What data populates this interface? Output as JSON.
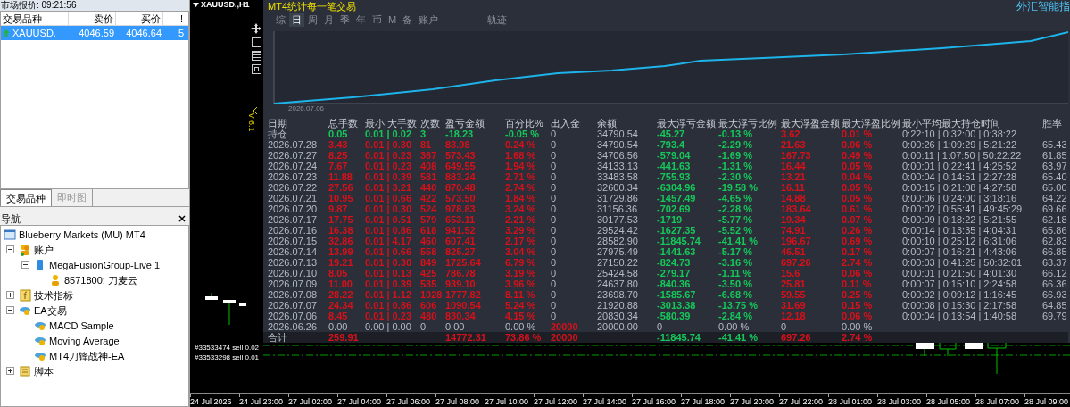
{
  "market_watch": {
    "title": "市场报价: 09:21:56",
    "columns": [
      "交易品种",
      "卖价",
      "买价",
      "!"
    ],
    "rows": [
      {
        "symbol": "XAUUSD.",
        "bid": "4046.59",
        "ask": "4046.64",
        "spread": "5",
        "selected": true
      }
    ],
    "tabs": [
      {
        "label": "交易品种",
        "selected": true
      },
      {
        "label": "即时图",
        "selected": false
      }
    ]
  },
  "navigator": {
    "title": "导航",
    "tree": [
      {
        "label": "Blueberry Markets (MU) MT4",
        "kind": "terminal",
        "children": [
          {
            "label": "账户",
            "kind": "accounts",
            "expanded": true,
            "children": [
              {
                "label": "MegaFusionGroup-Live 1",
                "kind": "server",
                "expanded": true,
                "children": [
                  {
                    "label": "8571800: 刀麦云",
                    "kind": "account"
                  }
                ]
              }
            ]
          },
          {
            "label": "技术指标",
            "kind": "indicators",
            "expanded": false
          },
          {
            "label": "EA交易",
            "kind": "experts",
            "expanded": true,
            "children": [
              {
                "label": "MACD Sample",
                "kind": "expert"
              },
              {
                "label": "Moving Average",
                "kind": "expert"
              },
              {
                "label": "MT4刀锋战神-EA",
                "kind": "expert"
              }
            ]
          },
          {
            "label": "脚本",
            "kind": "scripts",
            "expanded": false
          }
        ]
      }
    ]
  },
  "chart": {
    "symbol": "XAUUSD.,H1",
    "order_labels": [
      "#33533474 sell 0.02",
      "#33533298 sell 0.01"
    ],
    "time_axis": [
      "24 Jul 2026",
      "24 Jul 23:00",
      "27 Jul 02:00",
      "27 Jul 04:00",
      "27 Jul 06:00",
      "27 Jul 08:00",
      "27 Jul 10:00",
      "27 Jul 12:00",
      "27 Jul 14:00",
      "27 Jul 16:00",
      "27 Jul 18:00",
      "27 Jul 20:00",
      "27 Jul 22:00",
      "28 Jul 01:00",
      "28 Jul 03:00",
      "28 Jul 05:00",
      "28 Jul 07:00",
      "28 Jul 09:00"
    ]
  },
  "stats_panel": {
    "title": "MT4统计每一笔交易",
    "brand": "外汇智能指",
    "version": "V 6.1",
    "tabs": [
      {
        "label": "综",
        "selected": false
      },
      {
        "label": "日",
        "selected": true
      },
      {
        "label": "周",
        "selected": false
      },
      {
        "label": "月",
        "selected": false
      },
      {
        "label": "季",
        "selected": false
      },
      {
        "label": "年",
        "selected": false
      },
      {
        "label": "币",
        "selected": false
      },
      {
        "label": "M",
        "selected": false
      },
      {
        "label": "备",
        "selected": false
      },
      {
        "label": "账户",
        "selected": false
      },
      {
        "label": "轨迹",
        "selected": false
      }
    ],
    "equity_chart": {
      "start_date": "2026.07.06"
    },
    "table": {
      "columns": [
        "日期",
        "总手数",
        "最小|大手数",
        "次数",
        "盈亏金额",
        "百分比%",
        "出入金",
        "余额",
        "最大浮亏金额",
        "最大浮亏比例",
        "最大浮盈金额",
        "最大浮盈比例",
        "最小平均最大持仓时间",
        "胜率"
      ],
      "rows": [
        {
          "date": {
            "text": "持仓"
          },
          "total_lots": {
            "text": "0.05",
            "color": "#16c75a"
          },
          "min_max_lots": {
            "text": "0.01 | 0.02",
            "color": "#16c75a"
          },
          "trades": {
            "text": "3",
            "color": "#16c75a"
          },
          "profit": {
            "text": "-18.23",
            "color": "#16c75a"
          },
          "percent": {
            "text": "-0.05 %",
            "color": "#16c75a"
          },
          "deposit": {
            "text": "0"
          },
          "balance": {
            "text": "34790.54"
          },
          "max_float_loss": {
            "text": "-45.27",
            "color": "#16c75a"
          },
          "max_float_loss_pct": {
            "text": "-0.13 %",
            "color": "#16c75a"
          },
          "max_float_profit": {
            "text": "3.62",
            "color": "#d8101a"
          },
          "max_float_profit_pct": {
            "text": "0.01 %",
            "color": "#d8101a"
          },
          "hold_time": {
            "text": "0:22:10 | 0:32:00 | 0:38:22"
          }
        },
        {
          "date": {
            "text": "2026.07.28"
          },
          "total_lots": {
            "text": "3.43",
            "color": "#d8101a"
          },
          "min_max_lots": {
            "text": "0.01 | 0.30",
            "color": "#d8101a"
          },
          "trades": {
            "text": "81",
            "color": "#d8101a"
          },
          "profit": {
            "text": "83.98",
            "color": "#d8101a"
          },
          "percent": {
            "text": "0.24 %",
            "color": "#d8101a"
          },
          "deposit": {
            "text": "0"
          },
          "balance": {
            "text": "34790.54"
          },
          "max_float_loss": {
            "text": "-793.4",
            "color": "#16c75a"
          },
          "max_float_loss_pct": {
            "text": "-2.29 %",
            "color": "#16c75a"
          },
          "max_float_profit": {
            "text": "21.63",
            "color": "#d8101a"
          },
          "max_float_profit_pct": {
            "text": "0.06 %",
            "color": "#d8101a"
          },
          "hold_time": {
            "text": "0:00:26 | 1:09:29 | 5:21:22"
          },
          "win_rate": {
            "text": "65.43"
          }
        },
        {
          "date": {
            "text": "2026.07.27"
          },
          "total_lots": {
            "text": "8.25",
            "color": "#d8101a"
          },
          "min_max_lots": {
            "text": "0.01 | 0.23",
            "color": "#d8101a"
          },
          "trades": {
            "text": "367",
            "color": "#d8101a"
          },
          "profit": {
            "text": "573.43",
            "color": "#d8101a"
          },
          "percent": {
            "text": "1.68 %",
            "color": "#d8101a"
          },
          "deposit": {
            "text": "0"
          },
          "balance": {
            "text": "34706.56"
          },
          "max_float_loss": {
            "text": "-579.04",
            "color": "#16c75a"
          },
          "max_float_loss_pct": {
            "text": "-1.69 %",
            "color": "#16c75a"
          },
          "max_float_profit": {
            "text": "167.73",
            "color": "#d8101a"
          },
          "max_float_profit_pct": {
            "text": "0.49 %",
            "color": "#d8101a"
          },
          "hold_time": {
            "text": "0:00:11 | 1:07:50 | 50:22:22"
          },
          "win_rate": {
            "text": "61.85"
          }
        },
        {
          "date": {
            "text": "2026.07.24"
          },
          "total_lots": {
            "text": "7.67",
            "color": "#d8101a"
          },
          "min_max_lots": {
            "text": "0.01 | 0.23",
            "color": "#d8101a"
          },
          "trades": {
            "text": "408",
            "color": "#d8101a"
          },
          "profit": {
            "text": "649.55",
            "color": "#d8101a"
          },
          "percent": {
            "text": "1.94 %",
            "color": "#d8101a"
          },
          "deposit": {
            "text": "0"
          },
          "balance": {
            "text": "34133.13"
          },
          "max_float_loss": {
            "text": "-441.63",
            "color": "#16c75a"
          },
          "max_float_loss_pct": {
            "text": "-1.31 %",
            "color": "#16c75a"
          },
          "max_float_profit": {
            "text": "16.44",
            "color": "#d8101a"
          },
          "max_float_profit_pct": {
            "text": "0.05 %",
            "color": "#d8101a"
          },
          "hold_time": {
            "text": "0:00:01 | 0:22:41 | 4:25:52"
          },
          "win_rate": {
            "text": "63.97"
          }
        },
        {
          "date": {
            "text": "2026.07.23"
          },
          "total_lots": {
            "text": "11.88",
            "color": "#d8101a"
          },
          "min_max_lots": {
            "text": "0.01 | 0.39",
            "color": "#d8101a"
          },
          "trades": {
            "text": "581",
            "color": "#d8101a"
          },
          "profit": {
            "text": "883.24",
            "color": "#d8101a"
          },
          "percent": {
            "text": "2.71 %",
            "color": "#d8101a"
          },
          "deposit": {
            "text": "0"
          },
          "balance": {
            "text": "33483.58"
          },
          "max_float_loss": {
            "text": "-755.93",
            "color": "#16c75a"
          },
          "max_float_loss_pct": {
            "text": "-2.30 %",
            "color": "#16c75a"
          },
          "max_float_profit": {
            "text": "13.21",
            "color": "#d8101a"
          },
          "max_float_profit_pct": {
            "text": "0.04 %",
            "color": "#d8101a"
          },
          "hold_time": {
            "text": "0:00:04 | 0:14:51 | 2:27:28"
          },
          "win_rate": {
            "text": "65.40"
          }
        },
        {
          "date": {
            "text": "2026.07.22"
          },
          "total_lots": {
            "text": "27.56",
            "color": "#d8101a"
          },
          "min_max_lots": {
            "text": "0.01 | 3.21",
            "color": "#d8101a"
          },
          "trades": {
            "text": "440",
            "color": "#d8101a"
          },
          "profit": {
            "text": "870.48",
            "color": "#d8101a"
          },
          "percent": {
            "text": "2.74 %",
            "color": "#d8101a"
          },
          "deposit": {
            "text": "0"
          },
          "balance": {
            "text": "32600.34"
          },
          "max_float_loss": {
            "text": "-6304.96",
            "color": "#16c75a"
          },
          "max_float_loss_pct": {
            "text": "-19.58 %",
            "color": "#16c75a"
          },
          "max_float_profit": {
            "text": "16.11",
            "color": "#d8101a"
          },
          "max_float_profit_pct": {
            "text": "0.05 %",
            "color": "#d8101a"
          },
          "hold_time": {
            "text": "0:00:15 | 0:21:08 | 4:27:58"
          },
          "win_rate": {
            "text": "65.00"
          }
        },
        {
          "date": {
            "text": "2026.07.21"
          },
          "total_lots": {
            "text": "10.95",
            "color": "#d8101a"
          },
          "min_max_lots": {
            "text": "0.01 | 0.66",
            "color": "#d8101a"
          },
          "trades": {
            "text": "422",
            "color": "#d8101a"
          },
          "profit": {
            "text": "573.50",
            "color": "#d8101a"
          },
          "percent": {
            "text": "1.84 %",
            "color": "#d8101a"
          },
          "deposit": {
            "text": "0"
          },
          "balance": {
            "text": "31729.86"
          },
          "max_float_loss": {
            "text": "-1457.49",
            "color": "#16c75a"
          },
          "max_float_loss_pct": {
            "text": "-4.65 %",
            "color": "#16c75a"
          },
          "max_float_profit": {
            "text": "14.88",
            "color": "#d8101a"
          },
          "max_float_profit_pct": {
            "text": "0.05 %",
            "color": "#d8101a"
          },
          "hold_time": {
            "text": "0:00:06 | 0:24:00 | 3:18:16"
          },
          "win_rate": {
            "text": "64.22"
          }
        },
        {
          "date": {
            "text": "2026.07.20"
          },
          "total_lots": {
            "text": "9.87",
            "color": "#d8101a"
          },
          "min_max_lots": {
            "text": "0.01 | 0.30",
            "color": "#d8101a"
          },
          "trades": {
            "text": "524",
            "color": "#d8101a"
          },
          "profit": {
            "text": "978.83",
            "color": "#d8101a"
          },
          "percent": {
            "text": "3.24 %",
            "color": "#d8101a"
          },
          "deposit": {
            "text": "0"
          },
          "balance": {
            "text": "31156.36"
          },
          "max_float_loss": {
            "text": "-702.69",
            "color": "#16c75a"
          },
          "max_float_loss_pct": {
            "text": "-2.28 %",
            "color": "#16c75a"
          },
          "max_float_profit": {
            "text": "183.64",
            "color": "#d8101a"
          },
          "max_float_profit_pct": {
            "text": "0.61 %",
            "color": "#d8101a"
          },
          "hold_time": {
            "text": "0:00:02 | 0:55:41 | 49:45:29"
          },
          "win_rate": {
            "text": "69.66"
          }
        },
        {
          "date": {
            "text": "2026.07.17"
          },
          "total_lots": {
            "text": "17.75",
            "color": "#d8101a"
          },
          "min_max_lots": {
            "text": "0.01 | 0.51",
            "color": "#d8101a"
          },
          "trades": {
            "text": "579",
            "color": "#d8101a"
          },
          "profit": {
            "text": "653.11",
            "color": "#d8101a"
          },
          "percent": {
            "text": "2.21 %",
            "color": "#d8101a"
          },
          "deposit": {
            "text": "0"
          },
          "balance": {
            "text": "30177.53"
          },
          "max_float_loss": {
            "text": "-1719",
            "color": "#16c75a"
          },
          "max_float_loss_pct": {
            "text": "-5.77 %",
            "color": "#16c75a"
          },
          "max_float_profit": {
            "text": "19.34",
            "color": "#d8101a"
          },
          "max_float_profit_pct": {
            "text": "0.07 %",
            "color": "#d8101a"
          },
          "hold_time": {
            "text": "0:00:09 | 0:18:22 | 5:21:55"
          },
          "win_rate": {
            "text": "62.18"
          }
        },
        {
          "date": {
            "text": "2026.07.16"
          },
          "total_lots": {
            "text": "16.38",
            "color": "#d8101a"
          },
          "min_max_lots": {
            "text": "0.01 | 0.86",
            "color": "#d8101a"
          },
          "trades": {
            "text": "618",
            "color": "#d8101a"
          },
          "profit": {
            "text": "941.52",
            "color": "#d8101a"
          },
          "percent": {
            "text": "3.29 %",
            "color": "#d8101a"
          },
          "deposit": {
            "text": "0"
          },
          "balance": {
            "text": "29524.42"
          },
          "max_float_loss": {
            "text": "-1627.35",
            "color": "#16c75a"
          },
          "max_float_loss_pct": {
            "text": "-5.52 %",
            "color": "#16c75a"
          },
          "max_float_profit": {
            "text": "74.91",
            "color": "#d8101a"
          },
          "max_float_profit_pct": {
            "text": "0.26 %",
            "color": "#d8101a"
          },
          "hold_time": {
            "text": "0:00:14 | 0:13:35 | 4:04:31"
          },
          "win_rate": {
            "text": "65.86"
          }
        },
        {
          "date": {
            "text": "2026.07.15"
          },
          "total_lots": {
            "text": "32.86",
            "color": "#d8101a"
          },
          "min_max_lots": {
            "text": "0.01 | 4.17",
            "color": "#d8101a"
          },
          "trades": {
            "text": "460",
            "color": "#d8101a"
          },
          "profit": {
            "text": "607.41",
            "color": "#d8101a"
          },
          "percent": {
            "text": "2.17 %",
            "color": "#d8101a"
          },
          "deposit": {
            "text": "0"
          },
          "balance": {
            "text": "28582.90"
          },
          "max_float_loss": {
            "text": "-11845.74",
            "color": "#16c75a"
          },
          "max_float_loss_pct": {
            "text": "-41.41 %",
            "color": "#16c75a"
          },
          "max_float_profit": {
            "text": "196.67",
            "color": "#d8101a"
          },
          "max_float_profit_pct": {
            "text": "0.69 %",
            "color": "#d8101a"
          },
          "hold_time": {
            "text": "0:00:10 | 0:25:12 | 6:31:06"
          },
          "win_rate": {
            "text": "62.83"
          }
        },
        {
          "date": {
            "text": "2026.07.14"
          },
          "total_lots": {
            "text": "13.99",
            "color": "#d8101a"
          },
          "min_max_lots": {
            "text": "0.01 | 0.66",
            "color": "#d8101a"
          },
          "trades": {
            "text": "558",
            "color": "#d8101a"
          },
          "profit": {
            "text": "825.27",
            "color": "#d8101a"
          },
          "percent": {
            "text": "3.04 %",
            "color": "#d8101a"
          },
          "deposit": {
            "text": "0"
          },
          "balance": {
            "text": "27975.49"
          },
          "max_float_loss": {
            "text": "-1441.63",
            "color": "#16c75a"
          },
          "max_float_loss_pct": {
            "text": "-5.17 %",
            "color": "#16c75a"
          },
          "max_float_profit": {
            "text": "46.51",
            "color": "#d8101a"
          },
          "max_float_profit_pct": {
            "text": "0.17 %",
            "color": "#d8101a"
          },
          "hold_time": {
            "text": "0:00:07 | 0:16:21 | 4:43:06"
          },
          "win_rate": {
            "text": "66.85"
          }
        },
        {
          "date": {
            "text": "2026.07.13"
          },
          "total_lots": {
            "text": "19.21",
            "color": "#d8101a"
          },
          "min_max_lots": {
            "text": "0.01 | 0.30",
            "color": "#d8101a"
          },
          "trades": {
            "text": "849",
            "color": "#d8101a"
          },
          "profit": {
            "text": "1725.64",
            "color": "#d8101a"
          },
          "percent": {
            "text": "6.79 %",
            "color": "#d8101a"
          },
          "deposit": {
            "text": "0"
          },
          "balance": {
            "text": "27150.22"
          },
          "max_float_loss": {
            "text": "-824.73",
            "color": "#16c75a"
          },
          "max_float_loss_pct": {
            "text": "-3.16 %",
            "color": "#16c75a"
          },
          "max_float_profit": {
            "text": "697.26",
            "color": "#d8101a"
          },
          "max_float_profit_pct": {
            "text": "2.74 %",
            "color": "#d8101a"
          },
          "hold_time": {
            "text": "0:00:03 | 0:41:25 | 50:32:01"
          },
          "win_rate": {
            "text": "63.37"
          }
        },
        {
          "date": {
            "text": "2026.07.10"
          },
          "total_lots": {
            "text": "8.05",
            "color": "#d8101a"
          },
          "min_max_lots": {
            "text": "0.01 | 0.13",
            "color": "#d8101a"
          },
          "trades": {
            "text": "425",
            "color": "#d8101a"
          },
          "profit": {
            "text": "786.78",
            "color": "#d8101a"
          },
          "percent": {
            "text": "3.19 %",
            "color": "#d8101a"
          },
          "deposit": {
            "text": "0"
          },
          "balance": {
            "text": "25424.58"
          },
          "max_float_loss": {
            "text": "-279.17",
            "color": "#16c75a"
          },
          "max_float_loss_pct": {
            "text": "-1.11 %",
            "color": "#16c75a"
          },
          "max_float_profit": {
            "text": "15.6",
            "color": "#d8101a"
          },
          "max_float_profit_pct": {
            "text": "0.06 %",
            "color": "#d8101a"
          },
          "hold_time": {
            "text": "0:00:01 | 0:21:50 | 4:01:30"
          },
          "win_rate": {
            "text": "66.12"
          }
        },
        {
          "date": {
            "text": "2026.07.09"
          },
          "total_lots": {
            "text": "11.00",
            "color": "#d8101a"
          },
          "min_max_lots": {
            "text": "0.01 | 0.39",
            "color": "#d8101a"
          },
          "trades": {
            "text": "535",
            "color": "#d8101a"
          },
          "profit": {
            "text": "939.10",
            "color": "#d8101a"
          },
          "percent": {
            "text": "3.96 %",
            "color": "#d8101a"
          },
          "deposit": {
            "text": "0"
          },
          "balance": {
            "text": "24637.80"
          },
          "max_float_loss": {
            "text": "-840.36",
            "color": "#16c75a"
          },
          "max_float_loss_pct": {
            "text": "-3.50 %",
            "color": "#16c75a"
          },
          "max_float_profit": {
            "text": "25.81",
            "color": "#d8101a"
          },
          "max_float_profit_pct": {
            "text": "0.11 %",
            "color": "#d8101a"
          },
          "hold_time": {
            "text": "0:00:07 | 0:15:10 | 2:24:58"
          },
          "win_rate": {
            "text": "66.36"
          }
        },
        {
          "date": {
            "text": "2026.07.08"
          },
          "total_lots": {
            "text": "28.22",
            "color": "#d8101a"
          },
          "min_max_lots": {
            "text": "0.01 | 1.12",
            "color": "#d8101a"
          },
          "trades": {
            "text": "1028",
            "color": "#d8101a"
          },
          "profit": {
            "text": "1777.82",
            "color": "#d8101a"
          },
          "percent": {
            "text": "8.11 %",
            "color": "#d8101a"
          },
          "deposit": {
            "text": "0"
          },
          "balance": {
            "text": "23698.70"
          },
          "max_float_loss": {
            "text": "-1585.67",
            "color": "#16c75a"
          },
          "max_float_loss_pct": {
            "text": "-6.68 %",
            "color": "#16c75a"
          },
          "max_float_profit": {
            "text": "59.55",
            "color": "#d8101a"
          },
          "max_float_profit_pct": {
            "text": "0.25 %",
            "color": "#d8101a"
          },
          "hold_time": {
            "text": "0:00:02 | 0:09:12 | 1:16:45"
          },
          "win_rate": {
            "text": "66.93"
          }
        },
        {
          "date": {
            "text": "2026.07.07"
          },
          "total_lots": {
            "text": "24.34",
            "color": "#d8101a"
          },
          "min_max_lots": {
            "text": "0.01 | 0.86",
            "color": "#d8101a"
          },
          "trades": {
            "text": "606",
            "color": "#d8101a"
          },
          "profit": {
            "text": "1090.54",
            "color": "#d8101a"
          },
          "percent": {
            "text": "5.24 %",
            "color": "#d8101a"
          },
          "deposit": {
            "text": "0"
          },
          "balance": {
            "text": "21920.88"
          },
          "max_float_loss": {
            "text": "-3013.38",
            "color": "#16c75a"
          },
          "max_float_loss_pct": {
            "text": "-13.75 %",
            "color": "#16c75a"
          },
          "max_float_profit": {
            "text": "31.69",
            "color": "#d8101a"
          },
          "max_float_profit_pct": {
            "text": "0.15 %",
            "color": "#d8101a"
          },
          "hold_time": {
            "text": "0:00:08 | 0:15:30 | 2:17:58"
          },
          "win_rate": {
            "text": "64.85"
          }
        },
        {
          "date": {
            "text": "2026.07.06"
          },
          "total_lots": {
            "text": "8.45",
            "color": "#d8101a"
          },
          "min_max_lots": {
            "text": "0.01 | 0.23",
            "color": "#d8101a"
          },
          "trades": {
            "text": "480",
            "color": "#d8101a"
          },
          "profit": {
            "text": "830.34",
            "color": "#d8101a"
          },
          "percent": {
            "text": "4.15 %",
            "color": "#d8101a"
          },
          "deposit": {
            "text": "0"
          },
          "balance": {
            "text": "20830.34"
          },
          "max_float_loss": {
            "text": "-580.39",
            "color": "#16c75a"
          },
          "max_float_loss_pct": {
            "text": "-2.84 %",
            "color": "#16c75a"
          },
          "max_float_profit": {
            "text": "12.18",
            "color": "#d8101a"
          },
          "max_float_profit_pct": {
            "text": "0.06 %",
            "color": "#d8101a"
          },
          "hold_time": {
            "text": "0:00:04 | 0:13:54 | 1:40:58"
          },
          "win_rate": {
            "text": "69.79"
          }
        },
        {
          "date": {
            "text": "2026.06.26"
          },
          "total_lots": {
            "text": "0.00"
          },
          "min_max_lots": {
            "text": "0.00 | 0.00"
          },
          "trades": {
            "text": "0"
          },
          "profit": {
            "text": "0.00"
          },
          "percent": {
            "text": "0.00 %"
          },
          "deposit": {
            "text": "20000",
            "color": "#d8101a"
          },
          "balance": {
            "text": "20000.00"
          },
          "max_float_loss": {
            "text": "0"
          },
          "max_float_loss_pct": {
            "text": "0.00 %"
          },
          "max_float_profit": {
            "text": "0"
          },
          "max_float_profit_pct": {
            "text": "0.00 %"
          }
        },
        {
          "date": {
            "text": "合计"
          },
          "total_lots": {
            "text": "259.91",
            "color": "#d8101a"
          },
          "profit": {
            "text": "14772.31",
            "color": "#d8101a"
          },
          "percent": {
            "text": "73.86 %",
            "color": "#d8101a"
          },
          "deposit": {
            "text": "20000",
            "color": "#d8101a"
          },
          "max_float_loss": {
            "text": "-11845.74",
            "color": "#16c75a"
          },
          "max_float_loss_pct": {
            "text": "-41.41 %",
            "color": "#16c75a"
          },
          "max_float_profit": {
            "text": "697.26",
            "color": "#d8101a"
          },
          "max_float_profit_pct": {
            "text": "2.74 %",
            "color": "#d8101a"
          },
          "total": true
        }
      ]
    }
  }
}
